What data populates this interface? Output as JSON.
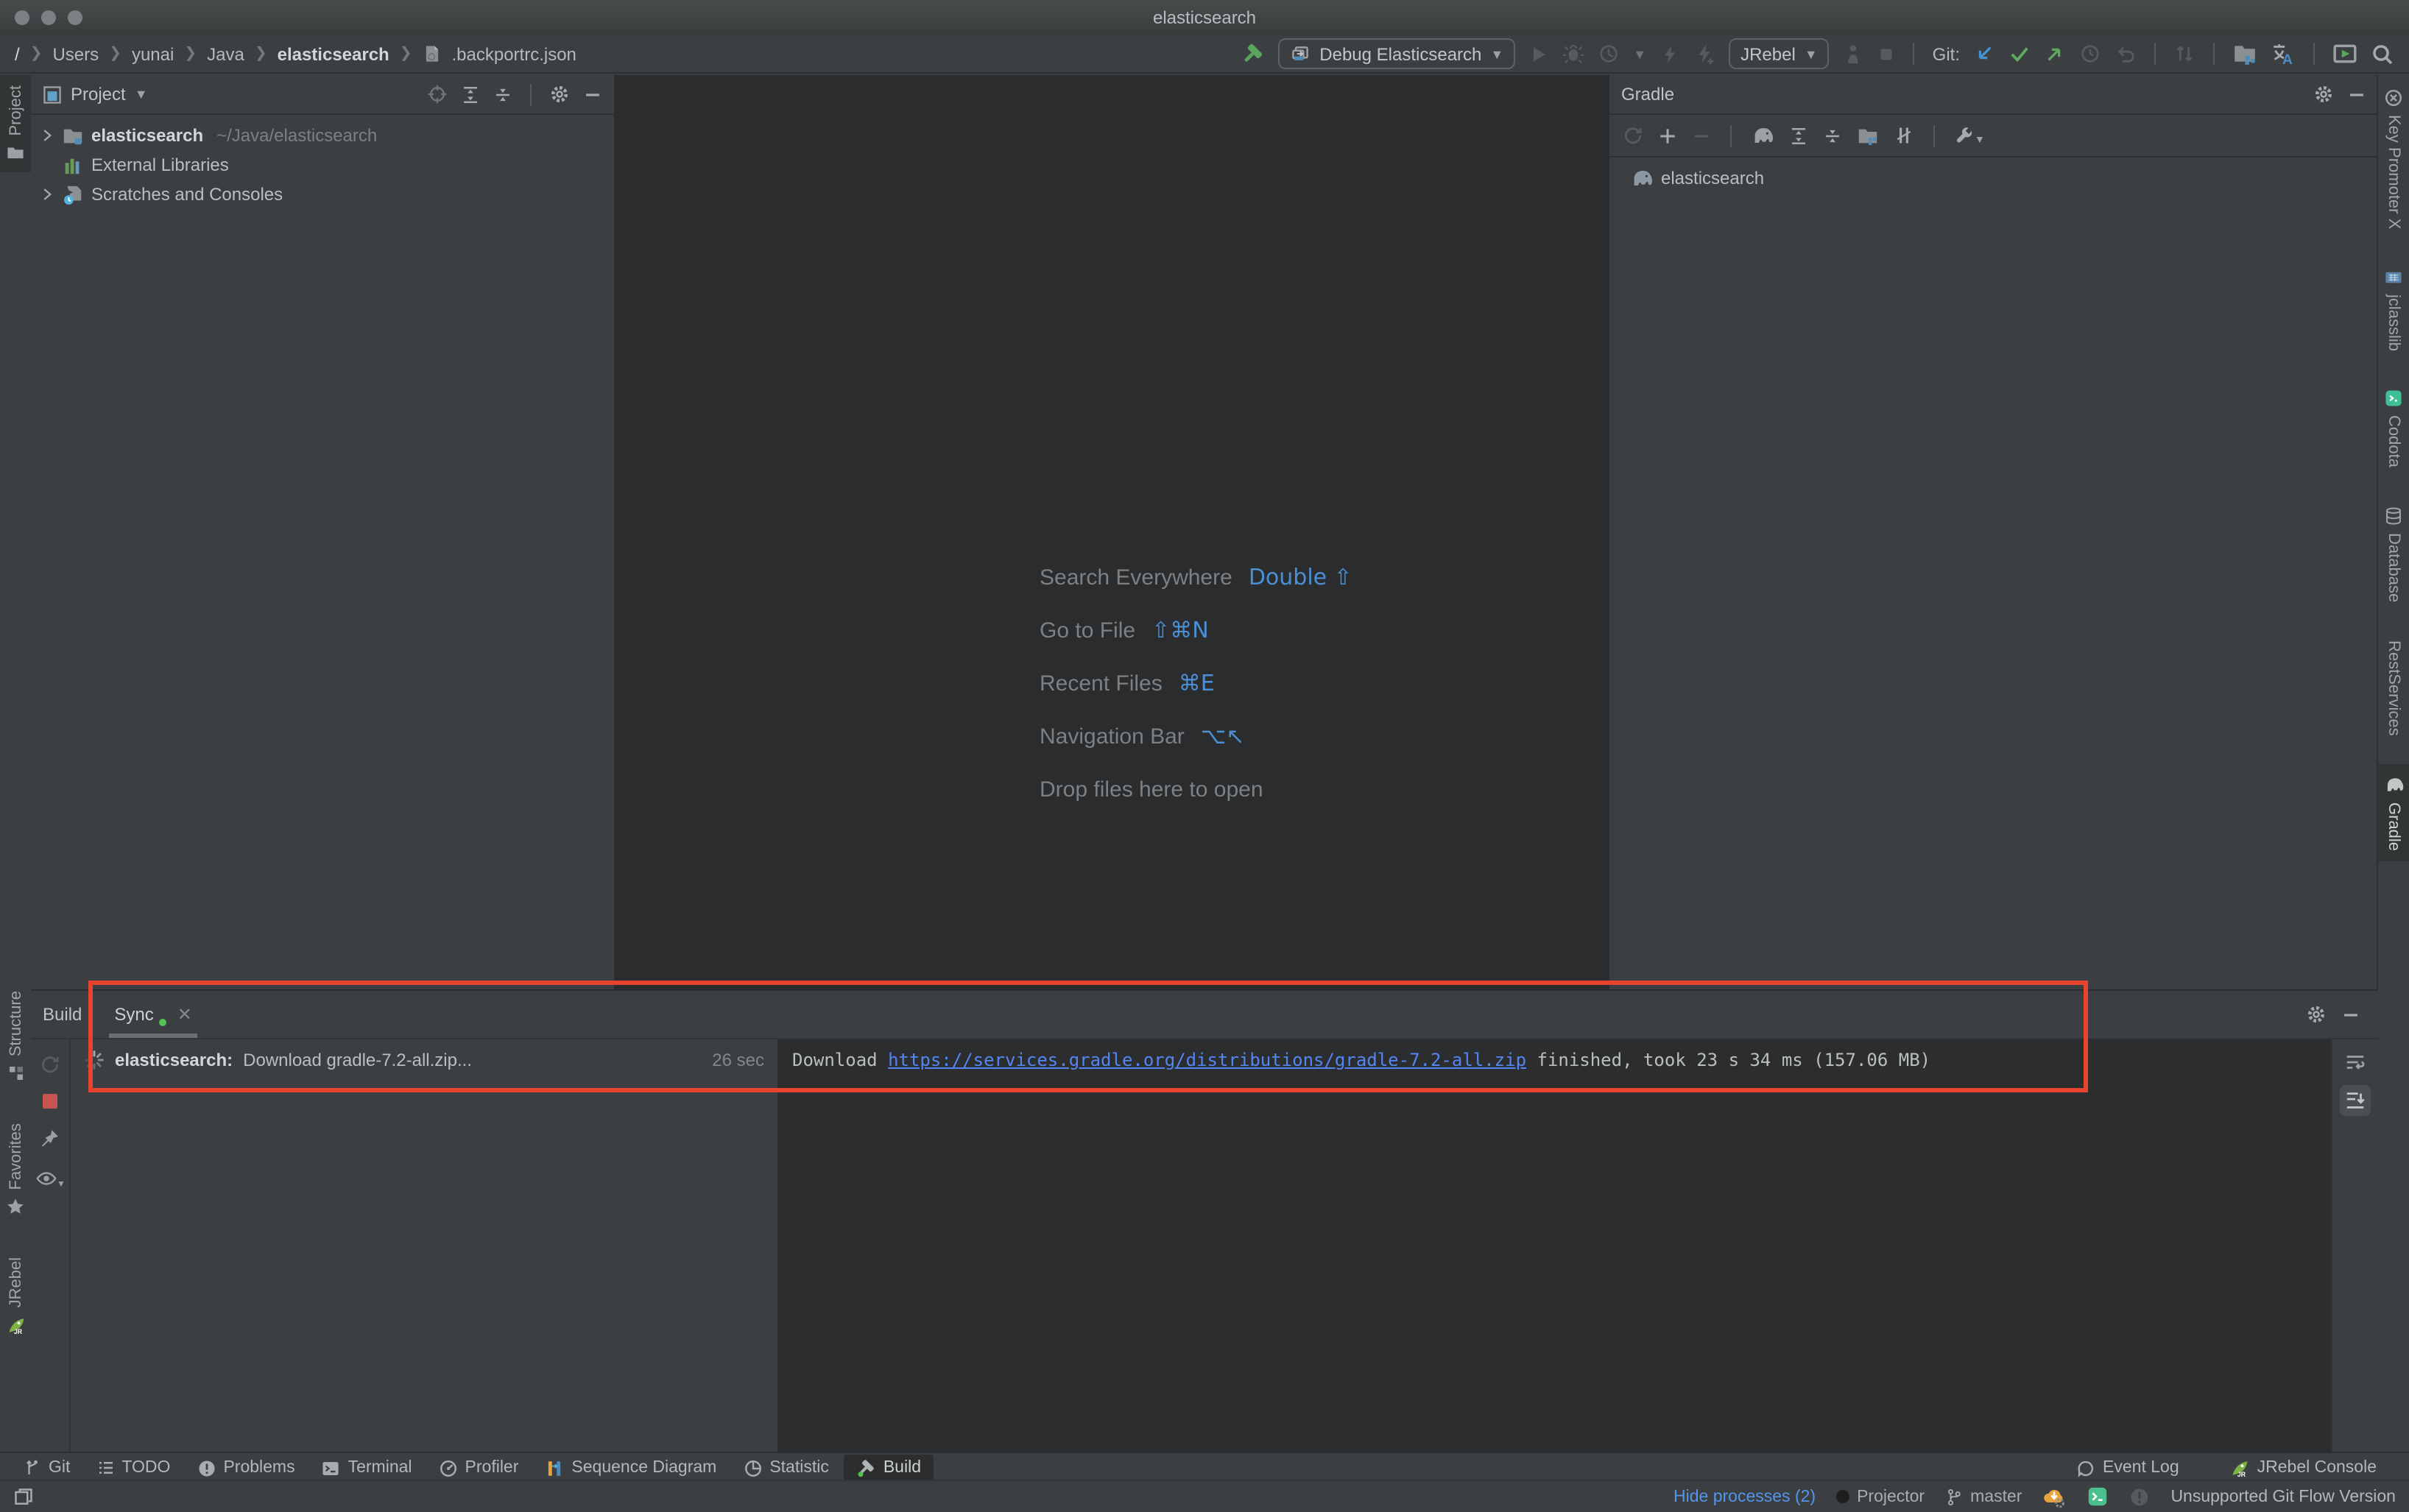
{
  "window": {
    "title": "elasticsearch"
  },
  "breadcrumbs": {
    "items": [
      {
        "label": "/"
      },
      {
        "label": "Users"
      },
      {
        "label": "yunai"
      },
      {
        "label": "Java"
      },
      {
        "label": "elasticsearch"
      },
      {
        "label": ".backportrc.json"
      }
    ]
  },
  "toolbar": {
    "run_config_label": "Debug Elasticsearch",
    "jrebel_label": "JRebel",
    "git_label": "Git:"
  },
  "left_stripe": {
    "project": "Project",
    "structure": "Structure",
    "favorites": "Favorites",
    "jrebel": "JRebel"
  },
  "project_panel": {
    "title": "Project",
    "items": [
      {
        "name": "elasticsearch",
        "detail": "~/Java/elasticsearch"
      },
      {
        "name": "External Libraries",
        "detail": ""
      },
      {
        "name": "Scratches and Consoles",
        "detail": ""
      }
    ]
  },
  "editor_overlay": {
    "shortcuts": [
      {
        "label": "Search Everywhere",
        "keys": "Double ⇧"
      },
      {
        "label": "Go to File",
        "keys": "⇧⌘N"
      },
      {
        "label": "Recent Files",
        "keys": "⌘E"
      },
      {
        "label": "Navigation Bar",
        "keys": "⌥↖"
      },
      {
        "label": "Drop files here to open",
        "keys": ""
      }
    ]
  },
  "gradle_panel": {
    "title": "Gradle",
    "items": [
      {
        "name": "elasticsearch"
      }
    ]
  },
  "right_stripe": {
    "items": [
      {
        "label": "Key Promoter X"
      },
      {
        "label": "jclasslib"
      },
      {
        "label": "Codota"
      },
      {
        "label": "Database"
      },
      {
        "label": "RestServices"
      },
      {
        "label": "Gradle"
      }
    ]
  },
  "build_panel": {
    "window_title": "Build",
    "active_tab": "Sync",
    "task": {
      "title": "elasticsearch:",
      "description": "Download gradle-7.2-all.zip...",
      "duration": "26 sec"
    },
    "console": {
      "prefix": "Download ",
      "link": "https://services.gradle.org/distributions/gradle-7.2-all.zip",
      "suffix": " finished, took 23 s 34 ms (157.06 MB)"
    }
  },
  "bottom_bar": {
    "items": [
      {
        "label": "Git"
      },
      {
        "label": "TODO"
      },
      {
        "label": "Problems"
      },
      {
        "label": "Terminal"
      },
      {
        "label": "Profiler"
      },
      {
        "label": "Sequence Diagram"
      },
      {
        "label": "Statistic"
      },
      {
        "label": "Build"
      }
    ],
    "right": [
      {
        "label": "Event Log"
      },
      {
        "label": "JRebel Console"
      }
    ]
  },
  "status_bar": {
    "hide_processes": "Hide processes (2)",
    "projector": "Projector",
    "branch": "master",
    "message": "Unsupported Git Flow Version"
  },
  "annotation": {
    "color": "#e8432e"
  }
}
